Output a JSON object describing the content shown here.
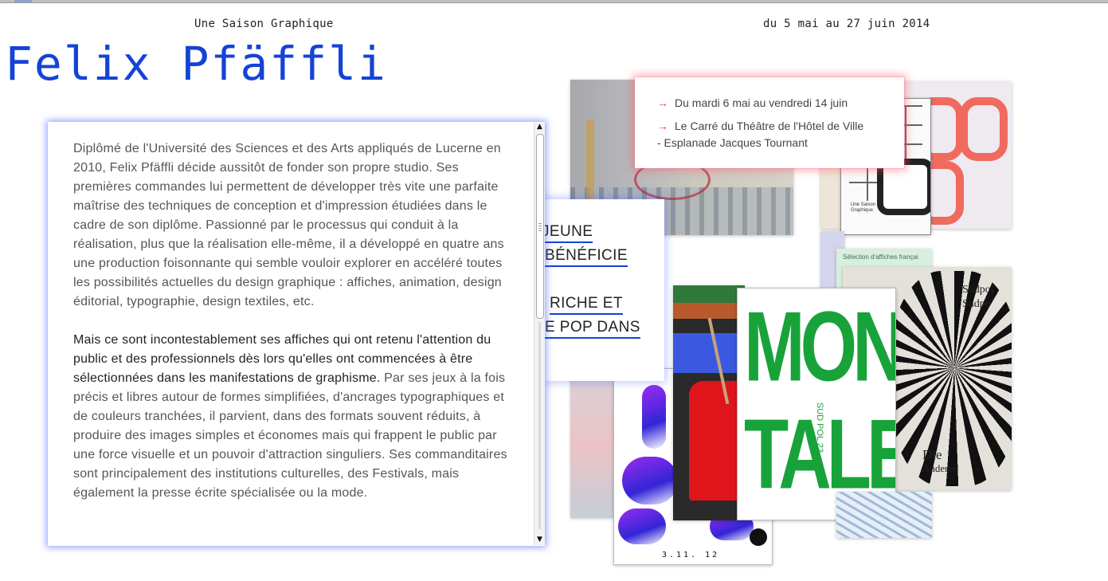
{
  "header": {
    "subtitle": "Une Saison Graphique",
    "dates": "du 5 mai au 27 juin 2014",
    "title": "Felix Pfäffli"
  },
  "info": {
    "line1": "Du mardi 6 mai au vendredi 14 juin",
    "line2": "Le Carré du Théâtre de l'Hôtel de Ville",
    "line3": "- Esplanade Jacques Tournant",
    "arrow": "→"
  },
  "teaser": {
    "l1": "JEUNE",
    "l2": "BÉNÉFICIE",
    "l3": "RICHE ET",
    "l4": "E POP DANS"
  },
  "article": {
    "p1": "Diplômé de l'Université des Sciences et des Arts appliqués de Lucerne en 2010, Felix Pfäffli décide aussitôt de fonder son propre studio. Ses premières commandes lui permettent de développer très vite une parfaite maîtrise des techniques de conception et d'impression étudiées dans le cadre de son diplôme. Passionné par le processus qui conduit à la réalisation, plus que la réalisation elle-même, il a développé en quatre ans une production foisonnante qui semble vouloir explorer en accéléré toutes les possibilités actuelles du design graphique : affiches, animation, design éditorial, typographie, design textiles, etc.",
    "p2_bold": "Mais ce sont incontestablement ses affiches qui ont retenu l'attention du public et des professionnels dès lors qu'elles ont commencées à être sélectionnées dans les manifestations de graphisme.",
    "p2_rest": " Par ses jeux à la fois précis et libres autour de formes simplifiées, d'ancrages typographiques et de couleurs tranchées, il parvient, dans des formats souvent réduits, à produire des images simples et économes mais qui frappent le public par une force visuelle et un pouvoir d'attraction singuliers. Ses commanditaires sont principalement des institutions culturelles, des Festivals, mais également la presse écrite spécialisée ou la mode."
  },
  "posters": {
    "mono_text": "MONO TALES",
    "mono_small": "SUD POL 23.",
    "purple_foot": "3.11.  12",
    "selection_head": "Sélection d'affiches françai",
    "black_text": "Südpol Sudpo",
    "black_bottom_big": "Die",
    "black_bottom": "Anderen",
    "bw_caption": "Une Saison Graphique"
  },
  "scrollbar": {
    "up": "▲",
    "down": "▼"
  },
  "colors": {
    "title_blue": "#1443d6",
    "arrow_red": "#e8413b",
    "poster_green": "#18a33a",
    "poster_red": "#e0141b"
  }
}
